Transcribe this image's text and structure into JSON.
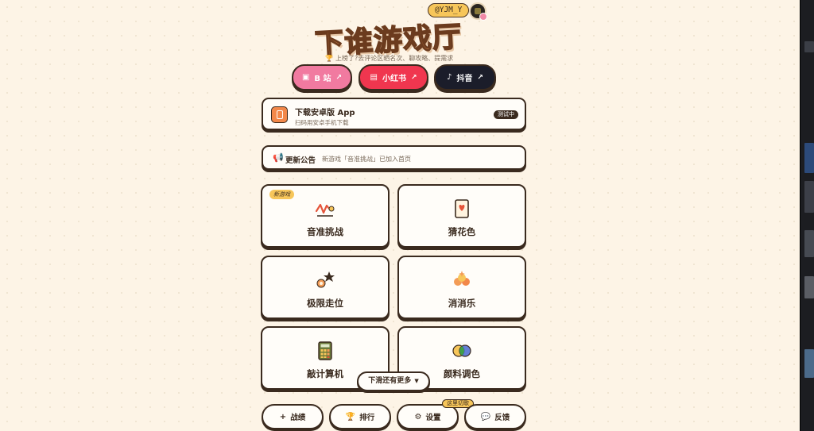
{
  "header": {
    "title": "下谁游戏厅",
    "user_tag": "@YJM_Y",
    "tagline_icon": "🏆",
    "tagline": "上榜了?去评论区晒名次、聊攻略、提需求"
  },
  "social": [
    {
      "label": "B 站",
      "icon": "bilibili-icon",
      "glyph": "▣",
      "arrow": "↗",
      "color": "#f17aa0"
    },
    {
      "label": "小红书",
      "icon": "xiaohongshu-icon",
      "glyph": "▤",
      "arrow": "↗",
      "color": "#f0364f"
    },
    {
      "label": "抖音",
      "icon": "douyin-icon",
      "glyph": "♪",
      "arrow": "↗",
      "color": "#1b1d2a"
    }
  ],
  "app_download": {
    "title": "下载安卓版 App",
    "subtitle": "扫码用安卓手机下载",
    "badge": "测试中"
  },
  "notice": {
    "icon": "📢",
    "title": "更新公告",
    "text": "新游戏「音准挑战」已加入首页"
  },
  "games": [
    {
      "name": "音准挑战",
      "icon": "pitch-wave-icon",
      "badge": "新游戏"
    },
    {
      "name": "猜花色",
      "icon": "playing-card-icon"
    },
    {
      "name": "极限走位",
      "icon": "dodge-star-icon"
    },
    {
      "name": "消消乐",
      "icon": "match-three-icon"
    },
    {
      "name": "敲计算机",
      "icon": "calculator-icon"
    },
    {
      "name": "颜料调色",
      "icon": "color-mix-icon"
    }
  ],
  "more_hint": {
    "label": "下滑还有更多",
    "chevron": "▼"
  },
  "bottom_nav": [
    {
      "label": "战绩",
      "glyph": "+",
      "icon": "plus-icon"
    },
    {
      "label": "排行",
      "glyph": "🏆",
      "icon": "trophy-icon"
    },
    {
      "label": "设置",
      "glyph": "⚙",
      "icon": "gear-icon",
      "tag": "这里切歌"
    },
    {
      "label": "反馈",
      "glyph": "💬",
      "icon": "chat-bubble-icon"
    }
  ],
  "colors": {
    "background": "#fdf4e6",
    "border": "#3a2a1e",
    "accent_orange": "#f39c57",
    "accent_yellow": "#f7c65a"
  }
}
